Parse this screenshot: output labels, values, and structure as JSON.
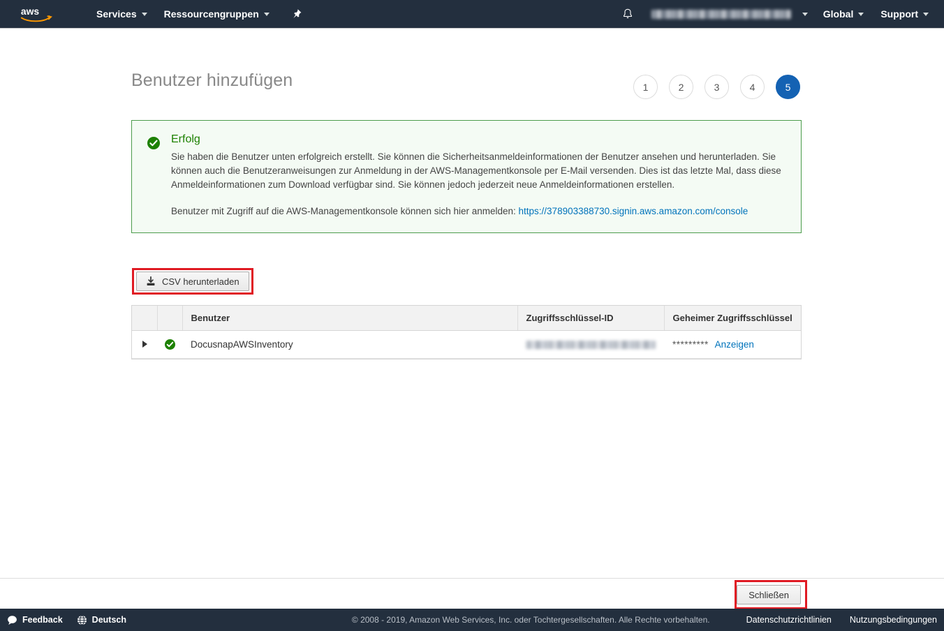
{
  "topnav": {
    "logo_alt": "aws",
    "items": [
      {
        "label": "Services",
        "has_caret": true
      },
      {
        "label": "Ressourcengruppen",
        "has_caret": true
      }
    ],
    "pin_icon": "pin-icon",
    "bell_icon": "bell-icon",
    "account_label": "",
    "region": "Global",
    "support": "Support"
  },
  "page": {
    "title": "Benutzer hinzufügen"
  },
  "steps": {
    "items": [
      "1",
      "2",
      "3",
      "4",
      "5"
    ],
    "active_index": 4,
    "active_color": "#1462b3"
  },
  "alert": {
    "status_icon": "success-check-icon",
    "title": "Erfolg",
    "title_color": "#1d8102",
    "border_color": "#4c9c4c",
    "body": "Sie haben die Benutzer unten erfolgreich erstellt. Sie können die Sicherheitsanmeldeinformationen der Benutzer ansehen und herunterladen. Sie können auch die Benutzeranweisungen zur Anmeldung in der AWS-Managementkonsole per E-Mail versenden. Dies ist das letzte Mal, dass diese Anmeldeinformationen zum Download verfügbar sind. Sie können jedoch jederzeit neue Anmeldeinformationen erstellen.",
    "signin_prefix": "Benutzer mit Zugriff auf die AWS-Managementkonsole können sich hier anmelden:",
    "signin_url": "https://378903388730.signin.aws.amazon.com/console"
  },
  "actions": {
    "download_csv": "CSV herunterladen",
    "download_icon": "download-icon",
    "close": "Schließen",
    "highlight_color": "#e01b24"
  },
  "table": {
    "headers": {
      "expand": "",
      "status": "",
      "user": "Benutzer",
      "access_key_id": "Zugriffsschlüssel-ID",
      "secret_access_key": "Geheimer Zugriffsschlüssel"
    },
    "rows": [
      {
        "user": "DocusnapAWSInventory",
        "status_icon": "success-check-icon",
        "access_key_id": "",
        "secret_mask": "*********",
        "secret_show_label": "Anzeigen"
      }
    ]
  },
  "footer": {
    "feedback": "Feedback",
    "feedback_icon": "speech-bubble-icon",
    "language": "Deutsch",
    "language_icon": "globe-icon",
    "copyright": "© 2008 - 2019, Amazon Web Services, Inc. oder Tochtergesellschaften. Alle Rechte vorbehalten.",
    "privacy": "Datenschutzrichtlinien",
    "terms": "Nutzungsbedingungen"
  }
}
